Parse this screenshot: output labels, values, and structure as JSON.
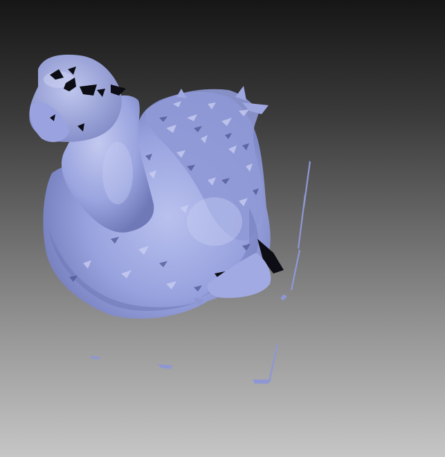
{
  "viewport": {
    "background_top": "#161616",
    "background_bottom": "#c6c6c6",
    "model_color": "#8f9ad6",
    "model_shadow_color": "#5c659e",
    "model_highlight_color": "#c3c9ee",
    "hole_color": "#0c0d14"
  },
  "model": {
    "name": "3d-mesh-swan",
    "render_mode": "shaded-surface"
  }
}
